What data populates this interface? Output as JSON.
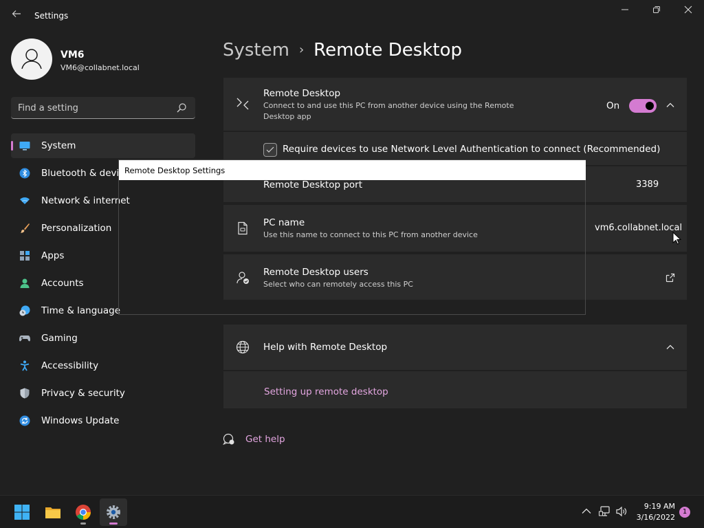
{
  "window": {
    "title": "Settings"
  },
  "user": {
    "name": "VM6",
    "email": "VM6@collabnet.local"
  },
  "search": {
    "placeholder": "Find a setting"
  },
  "sidebar": {
    "items": [
      {
        "label": "System",
        "icon": "monitor-icon",
        "active": true
      },
      {
        "label": "Bluetooth & devices",
        "icon": "bluetooth-icon"
      },
      {
        "label": "Network & internet",
        "icon": "wifi-icon"
      },
      {
        "label": "Personalization",
        "icon": "brush-icon"
      },
      {
        "label": "Apps",
        "icon": "apps-icon"
      },
      {
        "label": "Accounts",
        "icon": "person-icon"
      },
      {
        "label": "Time & language",
        "icon": "clock-globe-icon"
      },
      {
        "label": "Gaming",
        "icon": "gamepad-icon"
      },
      {
        "label": "Accessibility",
        "icon": "accessibility-icon"
      },
      {
        "label": "Privacy & security",
        "icon": "shield-icon"
      },
      {
        "label": "Windows Update",
        "icon": "update-icon"
      }
    ]
  },
  "breadcrumb": {
    "parent": "System",
    "current": "Remote Desktop"
  },
  "remote_desktop": {
    "title": "Remote Desktop",
    "description": "Connect to and use this PC from another device using the Remote Desktop app",
    "toggle_label": "On",
    "toggle_on": true
  },
  "nla": {
    "label": "Require devices to use Network Level Authentication to connect (Recommended)",
    "checked": true
  },
  "port": {
    "label": "Remote Desktop port",
    "value": "3389"
  },
  "pc_name": {
    "title": "PC name",
    "description": "Use this name to connect to this PC from another device",
    "value": "vm6.collabnet.local"
  },
  "users": {
    "title": "Remote Desktop users",
    "description": "Select who can remotely access this PC"
  },
  "dialog": {
    "title": "Remote Desktop Settings"
  },
  "help": {
    "title": "Help with Remote Desktop",
    "link": "Setting up remote desktop"
  },
  "get_help": {
    "label": "Get help"
  },
  "taskbar": {
    "time": "9:19 AM",
    "date": "3/16/2022",
    "notifications": "1"
  },
  "colors": {
    "accent": "#d47bd1",
    "background": "#202020",
    "card": "#2b2b2b",
    "link": "#e3a6e0"
  }
}
